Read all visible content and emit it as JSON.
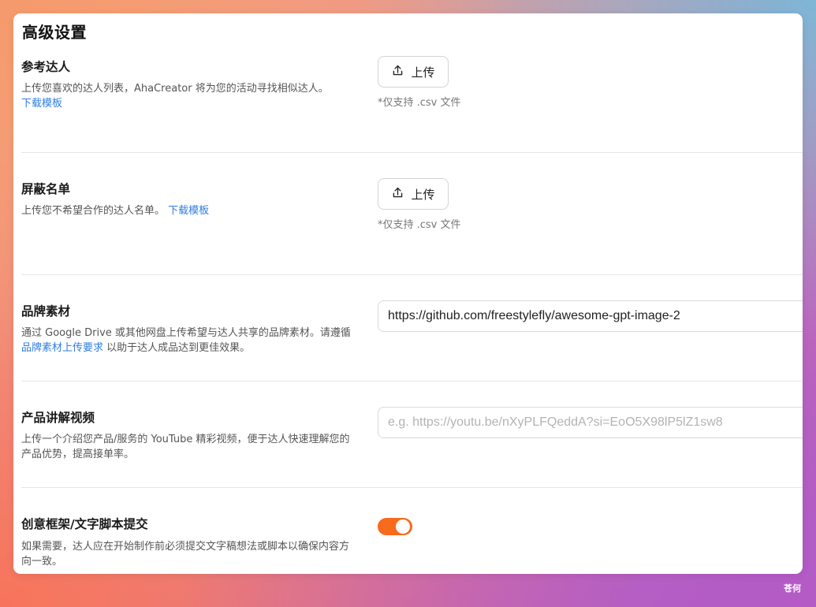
{
  "panel": {
    "title": "高级设置"
  },
  "reference_creators": {
    "title": "参考达人",
    "desc": "上传您喜欢的达人列表，AhaCreator 将为您的活动寻找相似达人。",
    "link": "下载模板",
    "upload_label": "上传",
    "hint": "*仅支持 .csv 文件"
  },
  "blocklist": {
    "title": "屏蔽名单",
    "desc": "上传您不希望合作的达人名单。",
    "link": "下载模板",
    "upload_label": "上传",
    "hint": "*仅支持 .csv 文件"
  },
  "brand_assets": {
    "title": "品牌素材",
    "desc_prefix": "通过 Google Drive 或其他网盘上传希望与达人共享的品牌素材。请遵循",
    "link": "品牌素材上传要求",
    "desc_suffix": "以助于达人成品达到更佳效果。",
    "input_value": "https://github.com/freestylefly/awesome-gpt-image-2"
  },
  "product_video": {
    "title": "产品讲解视频",
    "desc": "上传一个介绍您产品/服务的 YouTube 精彩视频，便于达人快速理解您的产品优势，提高接单率。",
    "input_placeholder": "e.g. https://youtu.be/nXyPLFQeddA?si=EoO5X98lP5lZ1sw8"
  },
  "creative_script": {
    "title": "创意框架/文字脚本提交",
    "desc": "如果需要，达人应在开始制作前必须提交文字稿想法或脚本以确保内容方向一致。",
    "toggle_on": true
  },
  "watermark": "苍何",
  "colors": {
    "accent": "#f86a1c",
    "link": "#2f7de1"
  }
}
